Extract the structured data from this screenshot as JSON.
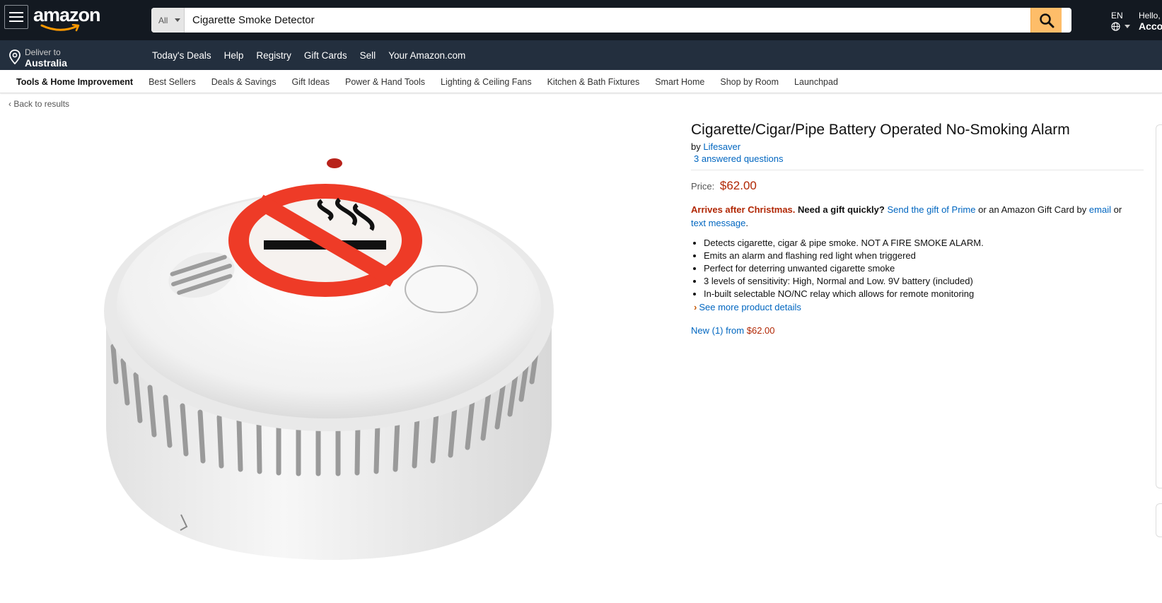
{
  "header": {
    "logo_text": "amazon",
    "search": {
      "department": "All",
      "query": "Cigarette Smoke Detector"
    },
    "language": "EN",
    "hello": "Hello,",
    "account": "Acco"
  },
  "nav": {
    "deliver_line1": "Deliver to",
    "deliver_line2": "Australia",
    "links": [
      "Today's Deals",
      "Help",
      "Registry",
      "Gift Cards",
      "Sell",
      "Your Amazon.com"
    ]
  },
  "subnav": {
    "items": [
      "Tools & Home Improvement",
      "Best Sellers",
      "Deals & Savings",
      "Gift Ideas",
      "Power & Hand Tools",
      "Lighting & Ceiling Fans",
      "Kitchen & Bath Fixtures",
      "Smart Home",
      "Shop by Room",
      "Launchpad"
    ]
  },
  "back_link": "Back to results",
  "product": {
    "title": "Cigarette/Cigar/Pipe Battery Operated No-Smoking Alarm",
    "by_prefix": "by",
    "brand": "Lifesaver",
    "answered": "3 answered questions",
    "price_label": "Price:",
    "price": "$62.00",
    "arrives_red": "Arrives after Christmas.",
    "arrives_bold": "Need a gift quickly?",
    "arrives_link1": "Send the gift of Prime",
    "arrives_mid": "or an Amazon Gift Card by",
    "arrives_link2": "email",
    "arrives_or": "or",
    "arrives_link3": "text message",
    "arrives_end": ".",
    "bullets": [
      "Detects cigarette, cigar & pipe smoke. NOT A FIRE SMOKE ALARM.",
      "Emits an alarm and flashing red light when triggered",
      "Perfect for deterring unwanted cigarette smoke",
      "3 levels of sensitivity: High, Normal and Low. 9V battery (included)",
      "In-built selectable NO/NC relay which allows for remote monitoring"
    ],
    "see_more": "See more product details",
    "new_from": "New (1) from",
    "new_price": "$62.00"
  },
  "colors": {
    "nav_dark": "#131921",
    "nav_secondary": "#232f3e",
    "search_button": "#febd69",
    "link": "#0066c0",
    "price_red": "#b12704",
    "no_smoking_red": "#ee3b27"
  }
}
